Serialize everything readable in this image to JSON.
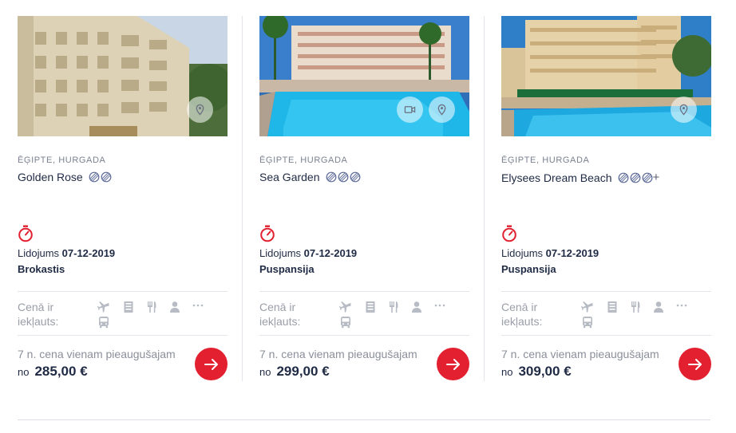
{
  "labels": {
    "flight_prefix": "Lidojums",
    "included_line1": "Cenā ir",
    "included_line2": "iekļauts:",
    "price_per_adult": "7 n. cena vienam pieaugušajam",
    "price_from": "no"
  },
  "colors": {
    "accent_red": "#e2202f",
    "text_dark": "#1f2a44",
    "text_muted": "#9a9ea8"
  },
  "included_icons": [
    "airplane-icon",
    "hotel-icon",
    "meals-icon",
    "person-icon",
    "more-icon",
    "bus-icon"
  ],
  "cards": [
    {
      "location": "ĒĢIPTE, HURGADA",
      "name": "Golden Rose",
      "rating": 2,
      "rating_plus": "",
      "flight_date": "07-12-2019",
      "board": "Brokastis",
      "price": "285,00 €",
      "photo_buttons": [
        "map-pin-icon"
      ]
    },
    {
      "location": "ĒĢIPTE, HURGADA",
      "name": "Sea Garden",
      "rating": 3,
      "rating_plus": "",
      "flight_date": "07-12-2019",
      "board": "Puspansija",
      "price": "299,00 €",
      "photo_buttons": [
        "video-icon",
        "map-pin-icon"
      ]
    },
    {
      "location": "ĒĢIPTE, HURGADA",
      "name": "Elysees Dream Beach",
      "rating": 3,
      "rating_plus": "+",
      "flight_date": "07-12-2019",
      "board": "Puspansija",
      "price": "309,00 €",
      "photo_buttons": [
        "map-pin-icon"
      ]
    }
  ]
}
